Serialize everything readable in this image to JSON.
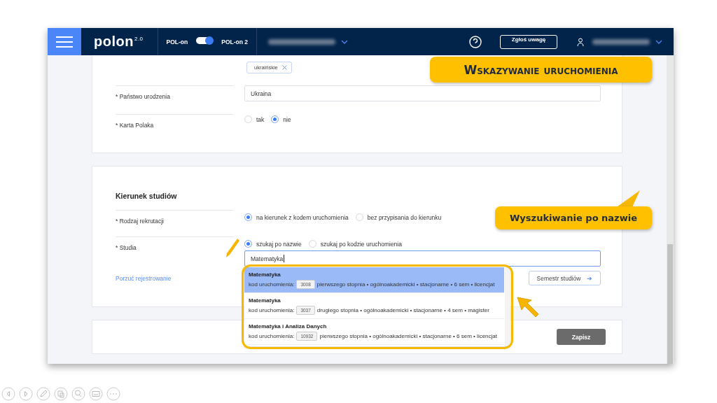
{
  "header": {
    "logo": "polon",
    "logo_version": "2.0",
    "toggle": {
      "left_label": "POL-on",
      "right_label": "POL-on 2",
      "on": true
    },
    "feedback_button": "Zgłoś uwagę"
  },
  "personal": {
    "tag": "ukraińskie",
    "fields": [
      {
        "label": "* Państwo urodzenia",
        "kind": "input",
        "value": "Ukraina"
      },
      {
        "label": "* Karta Polaka",
        "kind": "radio",
        "options": [
          {
            "label": "tak",
            "selected": false
          },
          {
            "label": "nie",
            "selected": true
          }
        ]
      }
    ]
  },
  "studies": {
    "title": "Kierunek studiów",
    "fields": [
      {
        "label": "* Rodzaj rekrutacji",
        "kind": "radio",
        "options": [
          {
            "label": "na kierunek z kodem uruchomienia",
            "selected": true
          },
          {
            "label": "bez przypisania do kierunku",
            "selected": false
          }
        ]
      },
      {
        "label": "* Studia",
        "kind": "search",
        "options": [
          {
            "label": "szukaj po nazwie",
            "selected": true
          },
          {
            "label": "szukaj po kodzie uruchomienia",
            "selected": false
          }
        ],
        "value": "Matematyka"
      }
    ],
    "dropdown": [
      {
        "name": "Matematyka",
        "code_label": "kod uruchomienia:",
        "code": "3008",
        "details": "pierwszego stopnia • ogólnoakademicki • stacjonarne • 6 sem • licencjat",
        "selected": true
      },
      {
        "name": "Matematyka",
        "code_label": "kod uruchomienia:",
        "code": "3037",
        "details": "drugiego stopnia • ogólnoakademicki • stacjonarne • 4 sem • magister",
        "selected": false
      },
      {
        "name": "Matematyka i Analiza Danych",
        "code_label": "kod uruchomienia:",
        "code": "10932",
        "details": "pierwszego stopnia • ogólnoakademicki • stacjonarne • 6 sem • licencjat",
        "selected": false
      }
    ],
    "abandon_link": "Porzuć rejestrowanie",
    "next_button": "Semestr studiów",
    "next_arrow": "➜"
  },
  "save_button": "Zapisz",
  "callouts": [
    {
      "text": "Wskazywanie uruchomienia",
      "kind": "title"
    },
    {
      "text": "Wyszukiwanie po nazwie",
      "kind": "pointer"
    }
  ]
}
